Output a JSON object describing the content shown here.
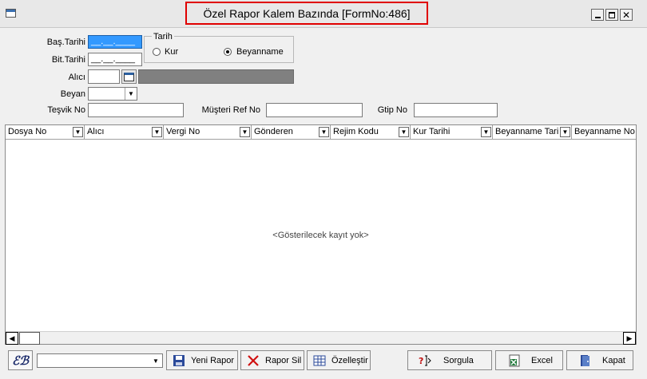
{
  "window": {
    "title": "Özel Rapor Kalem Bazında [FormNo:486]",
    "min_glyph": "",
    "max_glyph": "",
    "close_glyph": "✕"
  },
  "form": {
    "bas_tarihi_label": "Baş.Tarihi",
    "bas_tarihi_value": "__.__.____",
    "bit_tarihi_label": "Bit.Tarihi",
    "bit_tarihi_value": "__.__.____",
    "tarih_group_label": "Tarih",
    "radio_kur_label": "Kur",
    "radio_beyanname_label": "Beyanname",
    "selected_radio": "Beyanname",
    "alici_label": "Alıcı",
    "alici_value": "",
    "beyan_label": "Beyan",
    "beyan_value": "",
    "tesvik_label": "Teşvik No",
    "tesvik_value": "",
    "musteri_ref_label": "Müşteri Ref No",
    "musteri_ref_value": "",
    "gtip_label": "Gtip No",
    "gtip_value": ""
  },
  "grid": {
    "columns": [
      {
        "label": "Dosya No"
      },
      {
        "label": "Alıcı"
      },
      {
        "label": "Vergi No"
      },
      {
        "label": "Gönderen"
      },
      {
        "label": "Rejim Kodu"
      },
      {
        "label": "Kur Tarihi"
      },
      {
        "label": "Beyanname Tari"
      },
      {
        "label": "Beyanname No"
      }
    ],
    "empty_message": "<Gösterilecek kayıt yok>",
    "dropdown_glyph": "▼",
    "scroll_left_glyph": "◀",
    "scroll_right_glyph": "▶"
  },
  "toolbar": {
    "logo_text": "ℰℬ",
    "report_combo_value": "",
    "combo_glyph": "▼",
    "yeni_rapor_label": "Yeni Rapor",
    "rapor_sil_label": "Rapor Sil",
    "ozellestir_label": "Özelleştir",
    "sorgula_label": "Sorgula",
    "excel_label": "Excel",
    "kapat_label": "Kapat"
  },
  "icons": {
    "window_icon": "window-icon",
    "calendar": "calendar-icon",
    "save": "save-icon",
    "delete": "delete-x-icon",
    "customize": "grid-icon",
    "query": "query-icon",
    "excel": "excel-icon",
    "exit": "exit-door-icon"
  },
  "colors": {
    "selection": "#3399ff",
    "title_highlight": "#e00000",
    "readonly_field": "#808080",
    "delete_red": "#d01010",
    "excel_green": "#1f7a3a"
  }
}
